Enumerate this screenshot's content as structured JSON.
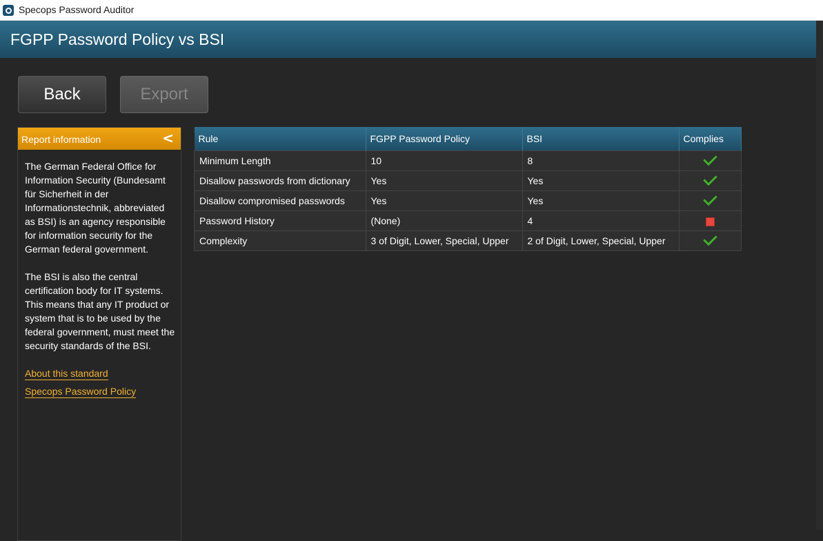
{
  "window": {
    "title": "Specops Password Auditor"
  },
  "page": {
    "title": "FGPP Password Policy vs BSI"
  },
  "buttons": {
    "back": "Back",
    "export": "Export"
  },
  "panel": {
    "title": "Report information",
    "collapse_icon": "<",
    "paragraph1": "The German Federal Office for Information Security (Bundesamt für Sicherheit in der Informationstechnik, abbreviated as BSI) is an agency responsible for information security for the German federal government.",
    "paragraph2": "The BSI is also the central certification body for IT systems. This means that any IT product or system that is to be used by the federal government, must meet the security standards of the BSI.",
    "link1": "About this standard",
    "link2": "Specops Password Policy"
  },
  "table": {
    "headers": [
      "Rule",
      "FGPP Password Policy",
      "BSI",
      "Complies"
    ],
    "rows": [
      {
        "rule": "Minimum Length",
        "policy": "10",
        "bsi": "8",
        "complies": "check-icon"
      },
      {
        "rule": "Disallow passwords from dictionary",
        "policy": "Yes",
        "bsi": "Yes",
        "complies": "check-icon"
      },
      {
        "rule": "Disallow compromised passwords",
        "policy": "Yes",
        "bsi": "Yes",
        "complies": "check-icon"
      },
      {
        "rule": "Password History",
        "policy": "(None)",
        "bsi": "4",
        "complies": "fail-icon"
      },
      {
        "rule": "Complexity",
        "policy": "3 of Digit, Lower, Special, Upper",
        "bsi": "2 of Digit, Lower, Special, Upper",
        "complies": "check-icon"
      }
    ]
  },
  "colors": {
    "header_blue": "#2f6e8c",
    "panel_orange": "#f0a514",
    "link": "#f4b131",
    "pass": "#3fae29",
    "fail": "#e8473e"
  }
}
